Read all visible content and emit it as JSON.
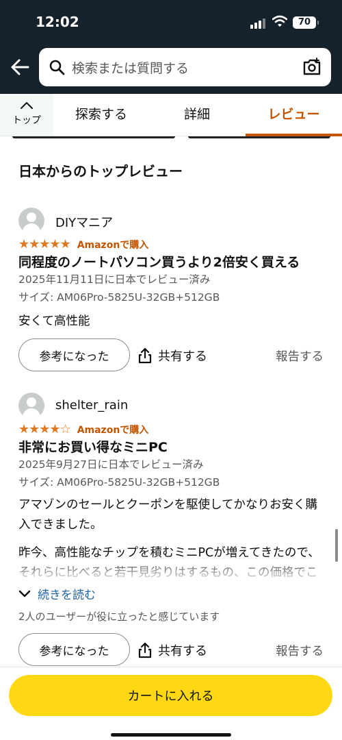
{
  "status_bar": {
    "time": "12:02",
    "battery": "70"
  },
  "search": {
    "placeholder": "検索または質問する"
  },
  "tabs": {
    "top": "トップ",
    "explore": "探索する",
    "details": "詳細",
    "reviews": "レビュー",
    "active": "reviews"
  },
  "section_title": "日本からのトップレビュー",
  "reviews": [
    {
      "author": "DIYマニア",
      "stars": 5,
      "stars_text": "★★★★★",
      "verified": "Amazonで購入",
      "title": "同程度のノートパソコン買うより2倍安く買える",
      "date": "2025年11月11日に日本でレビュー済み",
      "variant": "サイズ: AM06Pro-5825U-32GB+512GB",
      "body": "安くて高性能",
      "helpful_button": "参考になった",
      "share": "共有する",
      "report": "報告する"
    },
    {
      "author": "shelter_rain",
      "stars": 4,
      "stars_text": "★★★★☆",
      "verified": "Amazonで購入",
      "title": "非常にお買い得なミニPC",
      "date": "2025年9月27日に日本でレビュー済み",
      "variant": "サイズ: AM06Pro-5825U-32GB+512GB",
      "body": "アマゾンのセールとクーポンを駆使してかなりお安く購入できました。",
      "body_more": "昨今、高性能なチップを積むミニPCが増えてきたので、それらに比べると若干見劣りはするもの、この価格でこのスペックなら申し分ない",
      "read_more": "続きを読む",
      "helpful_count": "2人のユーザーが役に立ったと感じています",
      "helpful_button": "参考になった",
      "share": "共有する",
      "report": "報告する"
    }
  ],
  "cart_button": "カートに入れる",
  "colors": {
    "header": "#15212b",
    "accent": "#c45500",
    "star": "#de7921",
    "cart": "#ffd814",
    "link": "#2162a1"
  }
}
